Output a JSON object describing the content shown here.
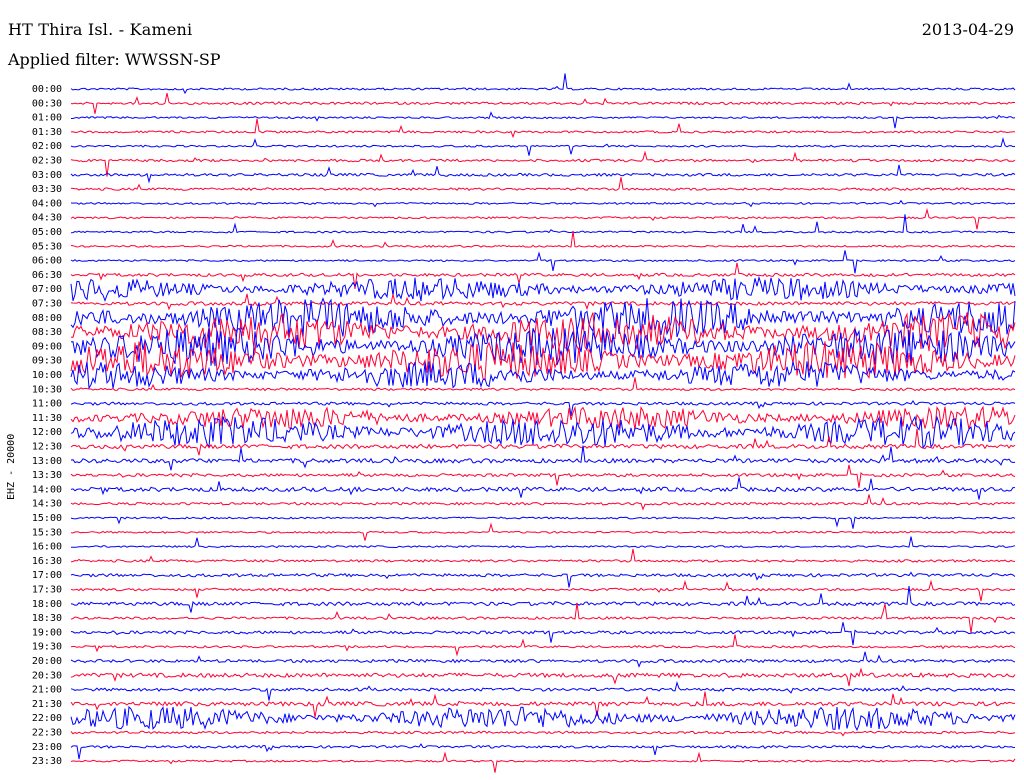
{
  "header": {
    "station": "HT Thira Isl. - Kameni",
    "filter": "Applied filter: WWSSN-SP",
    "date": "2013-04-29"
  },
  "axis": {
    "channel_label": "EHZ - 20000"
  },
  "colors": {
    "trace_a": "#0000ff",
    "trace_b": "#ff0033",
    "text": "#000000",
    "background": "#ffffff"
  },
  "chart_data": {
    "type": "line",
    "title": "HT Thira Isl. - Kameni",
    "subtitle": "Applied filter: WWSSN-SP",
    "ylabel": "EHZ - 20000",
    "y_tick_labels": [
      "00:00",
      "00:30",
      "01:00",
      "01:30",
      "02:00",
      "02:30",
      "03:00",
      "03:30",
      "04:00",
      "04:30",
      "05:00",
      "05:30",
      "06:00",
      "06:30",
      "07:00",
      "07:30",
      "08:00",
      "08:30",
      "09:00",
      "09:30",
      "10:00",
      "10:30",
      "11:00",
      "11:30",
      "12:00",
      "12:30",
      "13:00",
      "13:30",
      "14:00",
      "14:30",
      "15:00",
      "15:30",
      "16:00",
      "16:30",
      "17:00",
      "17:30",
      "18:00",
      "18:30",
      "19:00",
      "19:30",
      "20:00",
      "20:30",
      "21:00",
      "21:30",
      "22:00",
      "22:30",
      "23:00",
      "23:30"
    ],
    "trace_colors_alternate": [
      "blue",
      "red"
    ],
    "row_activity": [
      0.15,
      0.2,
      0.1,
      0.15,
      0.1,
      0.2,
      0.25,
      0.2,
      0.1,
      0.1,
      0.1,
      0.1,
      0.1,
      0.3,
      0.6,
      0.4,
      1.0,
      1.0,
      1.0,
      1.0,
      0.7,
      0.2,
      0.3,
      0.6,
      0.8,
      0.5,
      0.5,
      0.3,
      0.5,
      0.2,
      0.1,
      0.1,
      0.1,
      0.2,
      0.3,
      0.2,
      0.4,
      0.2,
      0.3,
      0.15,
      0.3,
      0.5,
      0.3,
      0.5,
      0.6,
      0.2,
      0.2,
      0.1
    ]
  }
}
